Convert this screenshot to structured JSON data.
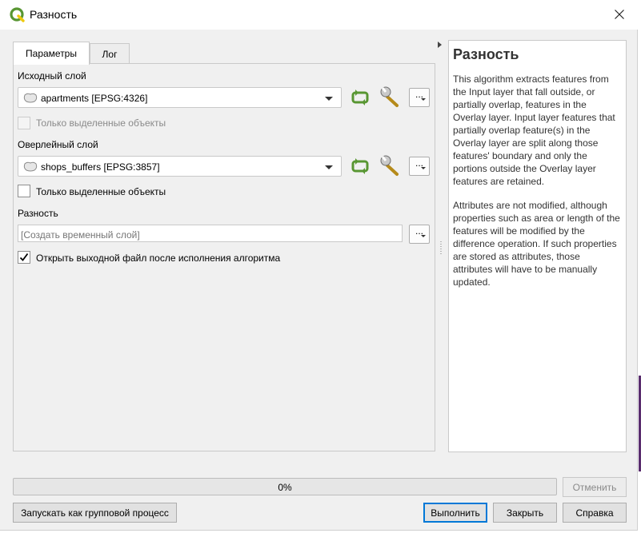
{
  "window": {
    "title": "Разность"
  },
  "tabs": [
    {
      "label": "Параметры",
      "active": true
    },
    {
      "label": "Лог",
      "active": false
    }
  ],
  "params": {
    "input_layer": {
      "label": "Исходный слой",
      "value": "apartments [EPSG:4326]",
      "selected_only_label": "Только выделенные объекты",
      "selected_only_checked": false,
      "selected_only_enabled": false
    },
    "overlay_layer": {
      "label": "Оверлейный слой",
      "value": "shops_buffers [EPSG:3857]",
      "selected_only_label": "Только выделенные объекты",
      "selected_only_checked": false,
      "selected_only_enabled": true
    },
    "output": {
      "label": "Разность",
      "placeholder": "[Создать временный слой]",
      "open_after_label": "Открыть выходной файл после исполнения алгоритма",
      "open_after_checked": true
    },
    "dots_label": "..."
  },
  "help": {
    "title": "Разность",
    "paragraphs": [
      "This algorithm extracts features from the Input layer that fall outside, or partially overlap, features in the Overlay layer. Input layer features that partially overlap feature(s) in the Overlay layer are split along those features' boundary and only the portions outside the Overlay layer features are retained.",
      "Attributes are not modified, although properties such as area or length of the features will be modified by the difference operation. If such properties are stored as attributes, those attributes will have to be manually updated."
    ]
  },
  "progress": {
    "value": 0,
    "text": "0%"
  },
  "buttons": {
    "cancel": "Отменить",
    "batch": "Запускать как групповой процесс",
    "run": "Выполнить",
    "close": "Закрыть",
    "help": "Справка"
  },
  "colors": {
    "accent": "#0078d7",
    "qgis_green": "#589632",
    "qgis_yellow": "#eec90d",
    "background": "#f0f0f0"
  },
  "icons": {
    "app": "qgis-logo-icon",
    "close": "close-icon",
    "layer": "polygon-layer-icon",
    "iterate": "iterate-icon",
    "settings": "wrench-icon"
  }
}
